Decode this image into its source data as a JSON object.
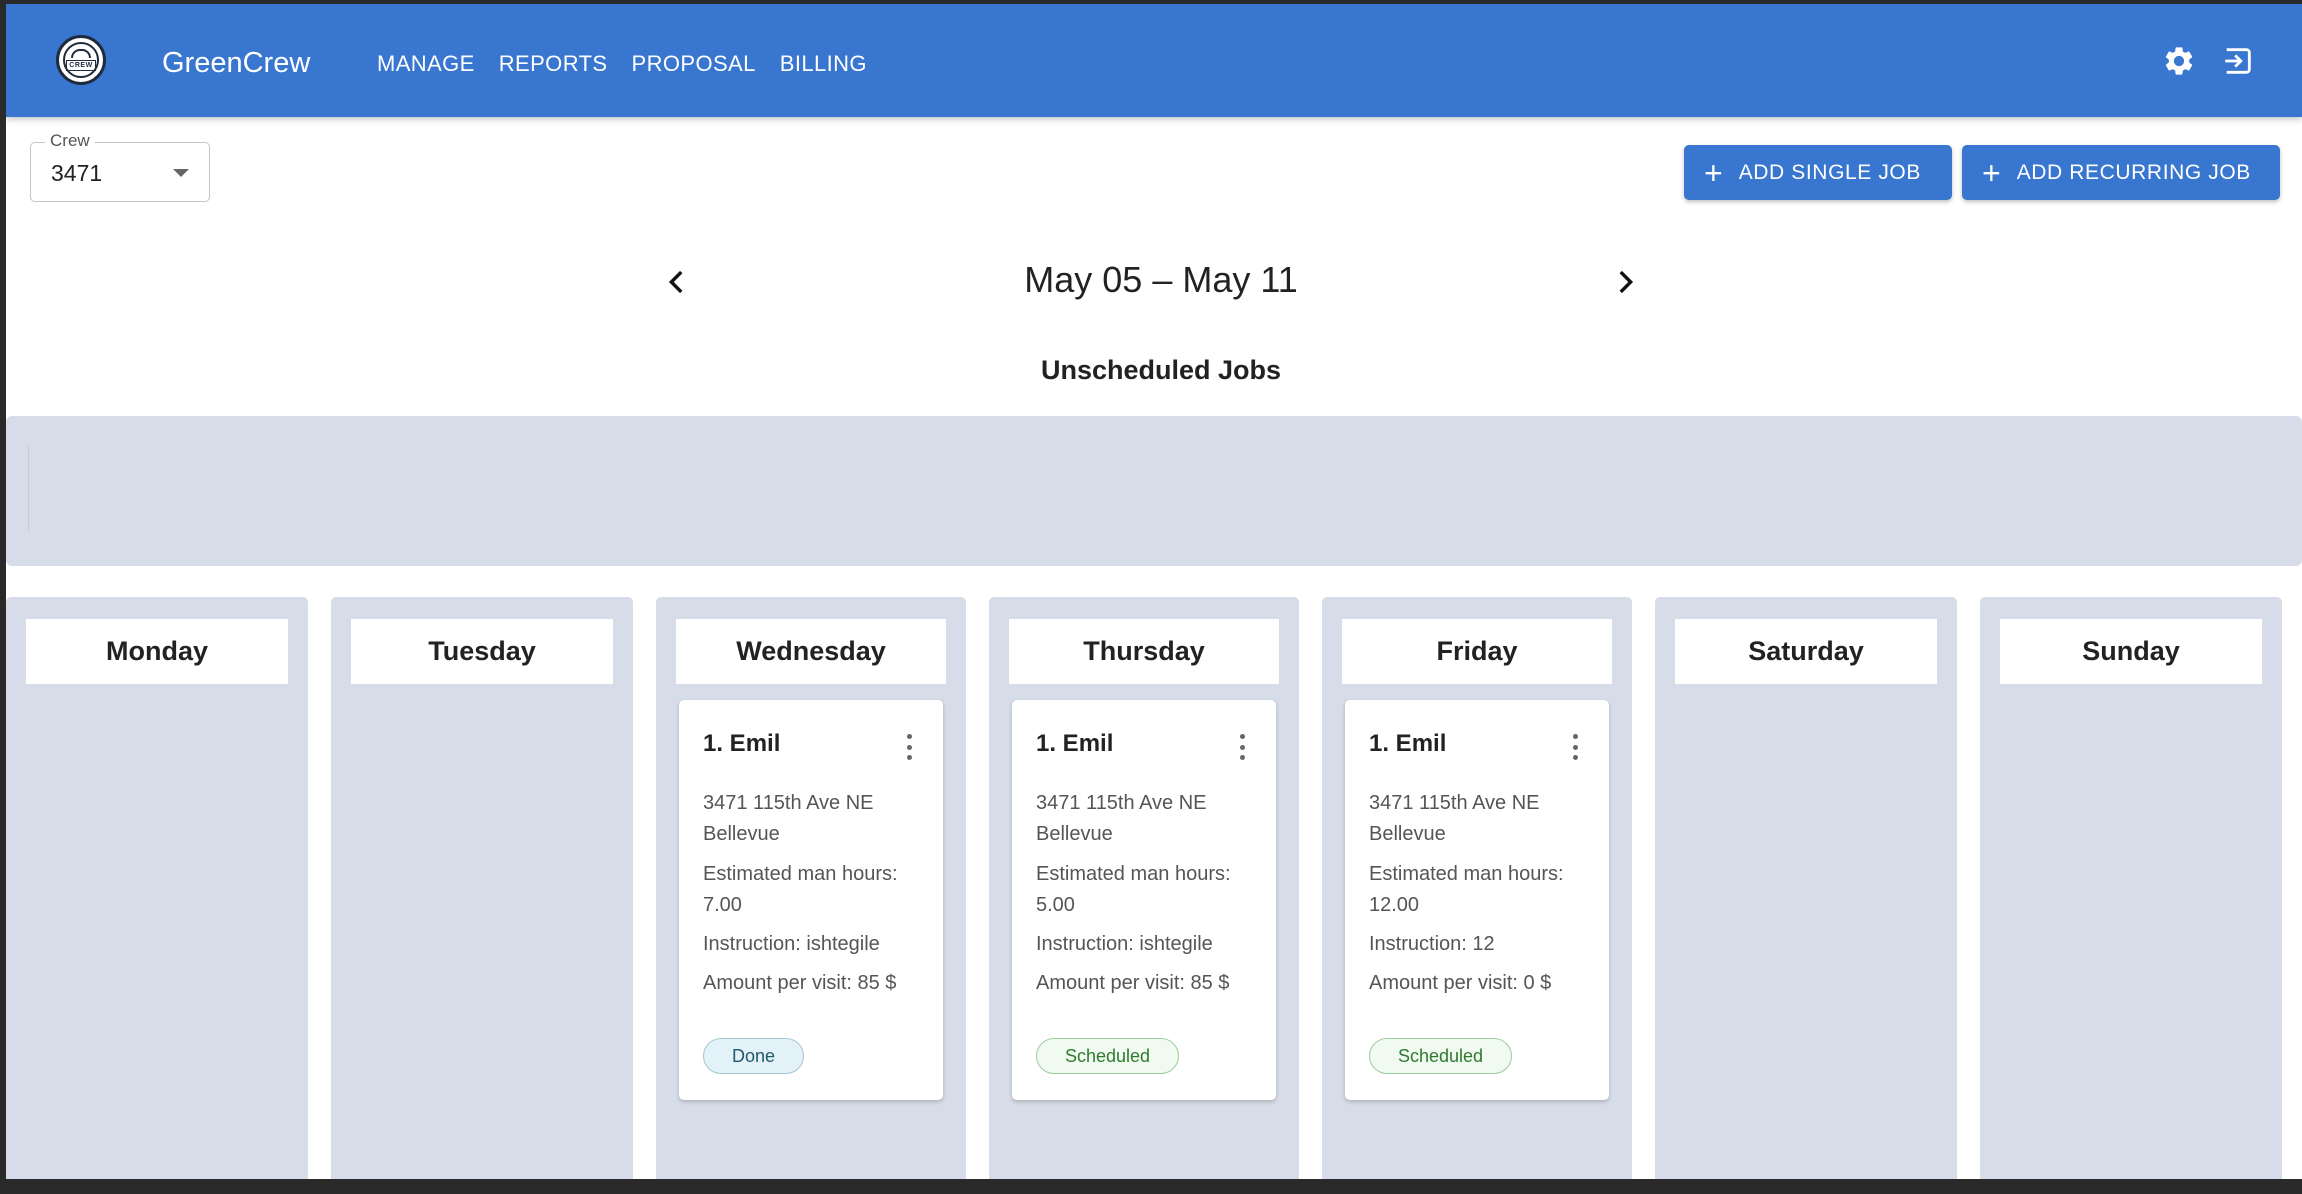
{
  "app": {
    "brand": "GreenCrew",
    "logo_text": "CREW"
  },
  "nav": [
    "MANAGE",
    "REPORTS",
    "PROPOSAL",
    "BILLING"
  ],
  "crew": {
    "label": "Crew",
    "value": "3471"
  },
  "actions": {
    "add_single": "ADD SINGLE JOB",
    "add_recurring": "ADD RECURRING JOB"
  },
  "week": {
    "range": "May 05 – May 11"
  },
  "unscheduled": {
    "title": "Unscheduled Jobs"
  },
  "days": [
    {
      "name": "Monday"
    },
    {
      "name": "Tuesday"
    },
    {
      "name": "Wednesday"
    },
    {
      "name": "Thursday"
    },
    {
      "name": "Friday"
    },
    {
      "name": "Saturday"
    },
    {
      "name": "Sunday"
    }
  ],
  "jobs": {
    "wednesday": {
      "title": "1. Emil",
      "address1": "3471 115th Ave NE",
      "address2": "Bellevue",
      "hours_label": "Estimated man hours:",
      "hours": "7.00",
      "instruction": "Instruction: ishtegile",
      "amount": "Amount per visit: 85 $",
      "status": "Done"
    },
    "thursday": {
      "title": "1. Emil",
      "address1": "3471 115th Ave NE",
      "address2": "Bellevue",
      "hours_label": "Estimated man hours:",
      "hours": "5.00",
      "instruction": "Instruction: ishtegile",
      "amount": "Amount per visit: 85 $",
      "status": "Scheduled"
    },
    "friday": {
      "title": "1. Emil",
      "address1": "3471 115th Ave NE",
      "address2": "Bellevue",
      "hours_label": "Estimated man hours:",
      "hours": "12.00",
      "instruction": "Instruction: 12",
      "amount": "Amount per visit: 0 $",
      "status": "Scheduled"
    }
  },
  "colors": {
    "primary": "#3876d0",
    "column_bg": "#d7dde8",
    "done": "#225a6c",
    "scheduled": "#2f7a2f"
  },
  "icons": {
    "settings": "gear-icon",
    "logout": "logout-icon",
    "prev": "chevron-left-icon",
    "next": "chevron-right-icon"
  }
}
